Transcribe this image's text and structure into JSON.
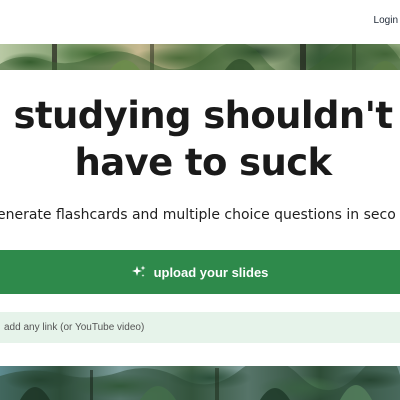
{
  "header": {
    "login_label": "Login"
  },
  "hero": {
    "headline_line1": "studying shouldn't",
    "headline_line2": "have to suck",
    "subheadline": "enerate flashcards and multiple choice questions in seco"
  },
  "actions": {
    "upload_label": "upload your slides",
    "upload_icon": "sparkle-icon",
    "link_input_value": "",
    "link_input_placeholder": "add any link (or YouTube video)"
  },
  "colors": {
    "primary_green": "#2e8a4b",
    "input_background": "#e6f3ea",
    "headline_text": "#1a1a1a"
  }
}
